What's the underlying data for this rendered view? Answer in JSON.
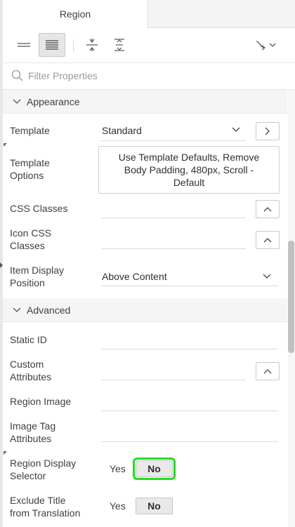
{
  "tabs": {
    "active": "Region",
    "inactive": ""
  },
  "filter": {
    "placeholder": "Filter Properties"
  },
  "groups": {
    "appearance": "Appearance",
    "advanced": "Advanced"
  },
  "props": {
    "template": {
      "label": "Template",
      "value": "Standard"
    },
    "template_options": {
      "label_1": "Template",
      "label_2": "Options",
      "value_1": "Use Template Defaults, Remove",
      "value_2": "Body Padding, 480px, Scroll -",
      "value_3": "Default"
    },
    "css_classes": {
      "label": "CSS Classes",
      "value": ""
    },
    "icon_css_classes": {
      "label_1": "Icon CSS",
      "label_2": "Classes",
      "value": ""
    },
    "item_display_position": {
      "label_1": "Item Display",
      "label_2": "Position",
      "value": "Above Content"
    },
    "static_id": {
      "label": "Static ID",
      "value": ""
    },
    "custom_attributes": {
      "label_1": "Custom",
      "label_2": "Attributes",
      "value": ""
    },
    "region_image": {
      "label": "Region Image",
      "value": ""
    },
    "image_tag_attributes": {
      "label_1": "Image Tag",
      "label_2": "Attributes",
      "value": ""
    },
    "region_display_selector": {
      "label_1": "Region Display",
      "label_2": "Selector",
      "yes": "Yes",
      "no": "No"
    },
    "exclude_title": {
      "label_1": "Exclude Title",
      "label_2": "from Translation",
      "yes": "Yes",
      "no": "No"
    }
  },
  "icons": [
    "single-column-icon",
    "two-column-icon",
    "collapse-all-icon",
    "expand-all-icon",
    "go-to-group-icon",
    "search-icon"
  ],
  "colors": {
    "focus_outline": "#22dd22",
    "marker": "#3a6ea5"
  }
}
